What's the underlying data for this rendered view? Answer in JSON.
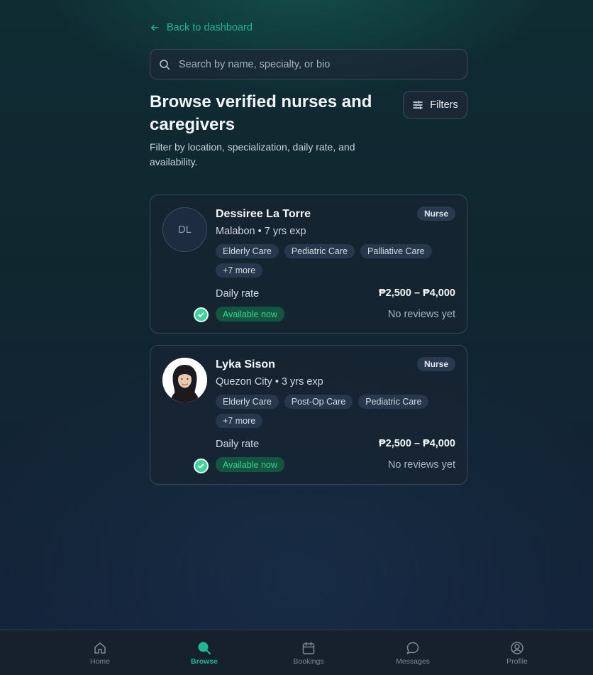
{
  "back_link": {
    "label": "Back to dashboard"
  },
  "search": {
    "placeholder": "Search by name, specialty, or bio",
    "value": ""
  },
  "header": {
    "title": "Browse verified nurses and caregivers",
    "subtitle": "Filter by location, specialization, daily rate, and availability.",
    "filters_label": "Filters"
  },
  "caregivers": [
    {
      "initials": "DL",
      "name": "Dessiree La Torre",
      "meta": "Malabon • 7 yrs exp",
      "role": "Nurse",
      "tags": [
        "Elderly Care",
        "Pediatric Care",
        "Palliative Care",
        "+7 more"
      ],
      "rate_label": "Daily rate",
      "rate": "₱2,500 – ₱4,000",
      "availability": "Available now",
      "reviews": "No reviews yet",
      "verified": true
    },
    {
      "initials": "",
      "name": "Lyka Sison",
      "meta": "Quezon City • 3 yrs exp",
      "role": "Nurse",
      "tags": [
        "Elderly Care",
        "Post-Op Care",
        "Pediatric Care",
        "+7 more"
      ],
      "rate_label": "Daily rate",
      "rate": "₱2,500 – ₱4,000",
      "availability": "Available now",
      "reviews": "No reviews yet",
      "verified": true
    }
  ],
  "nav": {
    "items": [
      {
        "label": "Home",
        "icon": "home-icon"
      },
      {
        "label": "Browse",
        "icon": "search-icon",
        "active": true
      },
      {
        "label": "Bookings",
        "icon": "calendar-icon"
      },
      {
        "label": "Messages",
        "icon": "chat-bubble-icon"
      },
      {
        "label": "Profile",
        "icon": "user-circle-icon"
      }
    ]
  },
  "colors": {
    "accent": "#1fb894",
    "available_bg": "#14553f",
    "available_text": "#35d39a",
    "verified": "#3fd39a"
  }
}
